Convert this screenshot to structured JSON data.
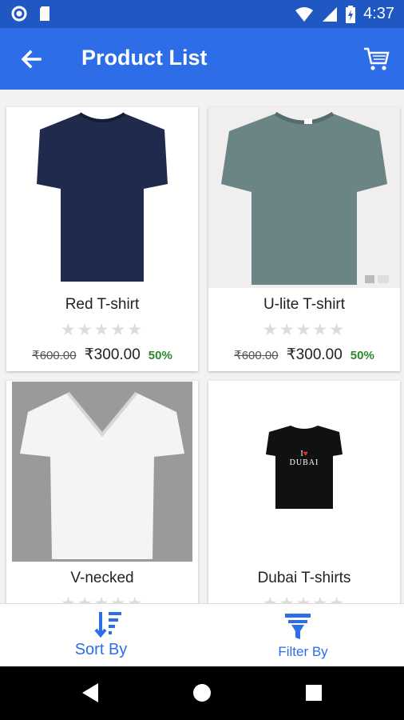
{
  "status_bar": {
    "time": "4:37"
  },
  "app_bar": {
    "title": "Product List"
  },
  "products": [
    {
      "name": "Red T-shirt",
      "old_price": "₹600.00",
      "price": "₹300.00",
      "discount": "50%",
      "rating": 0
    },
    {
      "name": "U-lite T-shirt",
      "old_price": "₹600.00",
      "price": "₹300.00",
      "discount": "50%",
      "rating": 0
    },
    {
      "name": "V-necked",
      "rating": 0
    },
    {
      "name": "Dubai T-shirts",
      "rating": 0
    }
  ],
  "dubai_print": {
    "line1": "I",
    "line2": "DUBAI"
  },
  "bottom_bar": {
    "sort_label": "Sort By",
    "filter_label": "Filter By"
  },
  "colors": {
    "accent": "#2d6ee8",
    "status_bar": "#1f57c3",
    "discount": "#2a8a2a"
  }
}
